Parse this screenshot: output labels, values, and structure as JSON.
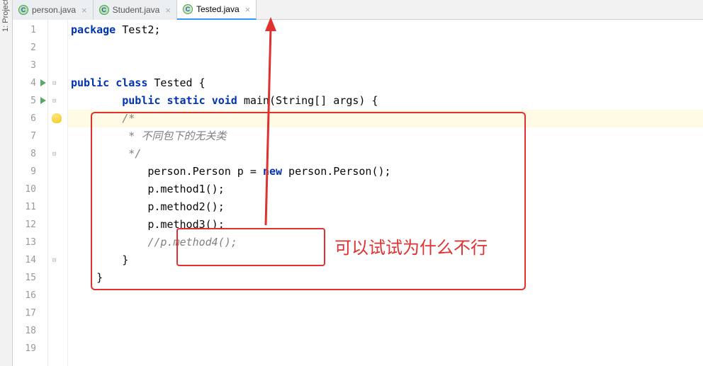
{
  "sidebar": {
    "label": "1: Project"
  },
  "tabs": [
    {
      "label": "person.java",
      "active": false
    },
    {
      "label": "Student.java",
      "active": false
    },
    {
      "label": "Tested.java",
      "active": true
    }
  ],
  "lines": {
    "l1": {
      "num": "1"
    },
    "l2": {
      "num": "2"
    },
    "l3": {
      "num": "3"
    },
    "l4": {
      "num": "4"
    },
    "l5": {
      "num": "5"
    },
    "l6": {
      "num": "6"
    },
    "l7": {
      "num": "7"
    },
    "l8": {
      "num": "8"
    },
    "l9": {
      "num": "9"
    },
    "l10": {
      "num": "10"
    },
    "l11": {
      "num": "11"
    },
    "l12": {
      "num": "12"
    },
    "l13": {
      "num": "13"
    },
    "l14": {
      "num": "14"
    },
    "l15": {
      "num": "15"
    },
    "l16": {
      "num": "16"
    },
    "l17": {
      "num": "17"
    },
    "l18": {
      "num": "18"
    },
    "l19": {
      "num": "19"
    }
  },
  "code": {
    "kw_package": "package",
    "pkg_name": " Test2;",
    "kw_public": "public",
    "kw_class": "class",
    "class_name": " Tested {",
    "kw_static": "static",
    "kw_void": "void",
    "main_sig": " main(String[] args) {",
    "c6a": "        /*",
    "c7": "         * 不同包下的无关类",
    "c8": "         */",
    "l9a": "            person.Person p = ",
    "kw_new": "new",
    "l9b": " person.Person();",
    "l10": "            p.method1();",
    "l11": "            p.method2();",
    "l12": "            p.method3();",
    "l13": "            //p.method4();",
    "l14": "        }",
    "l15": "    }"
  },
  "annotation": {
    "text": "可以试试为什么不行"
  }
}
